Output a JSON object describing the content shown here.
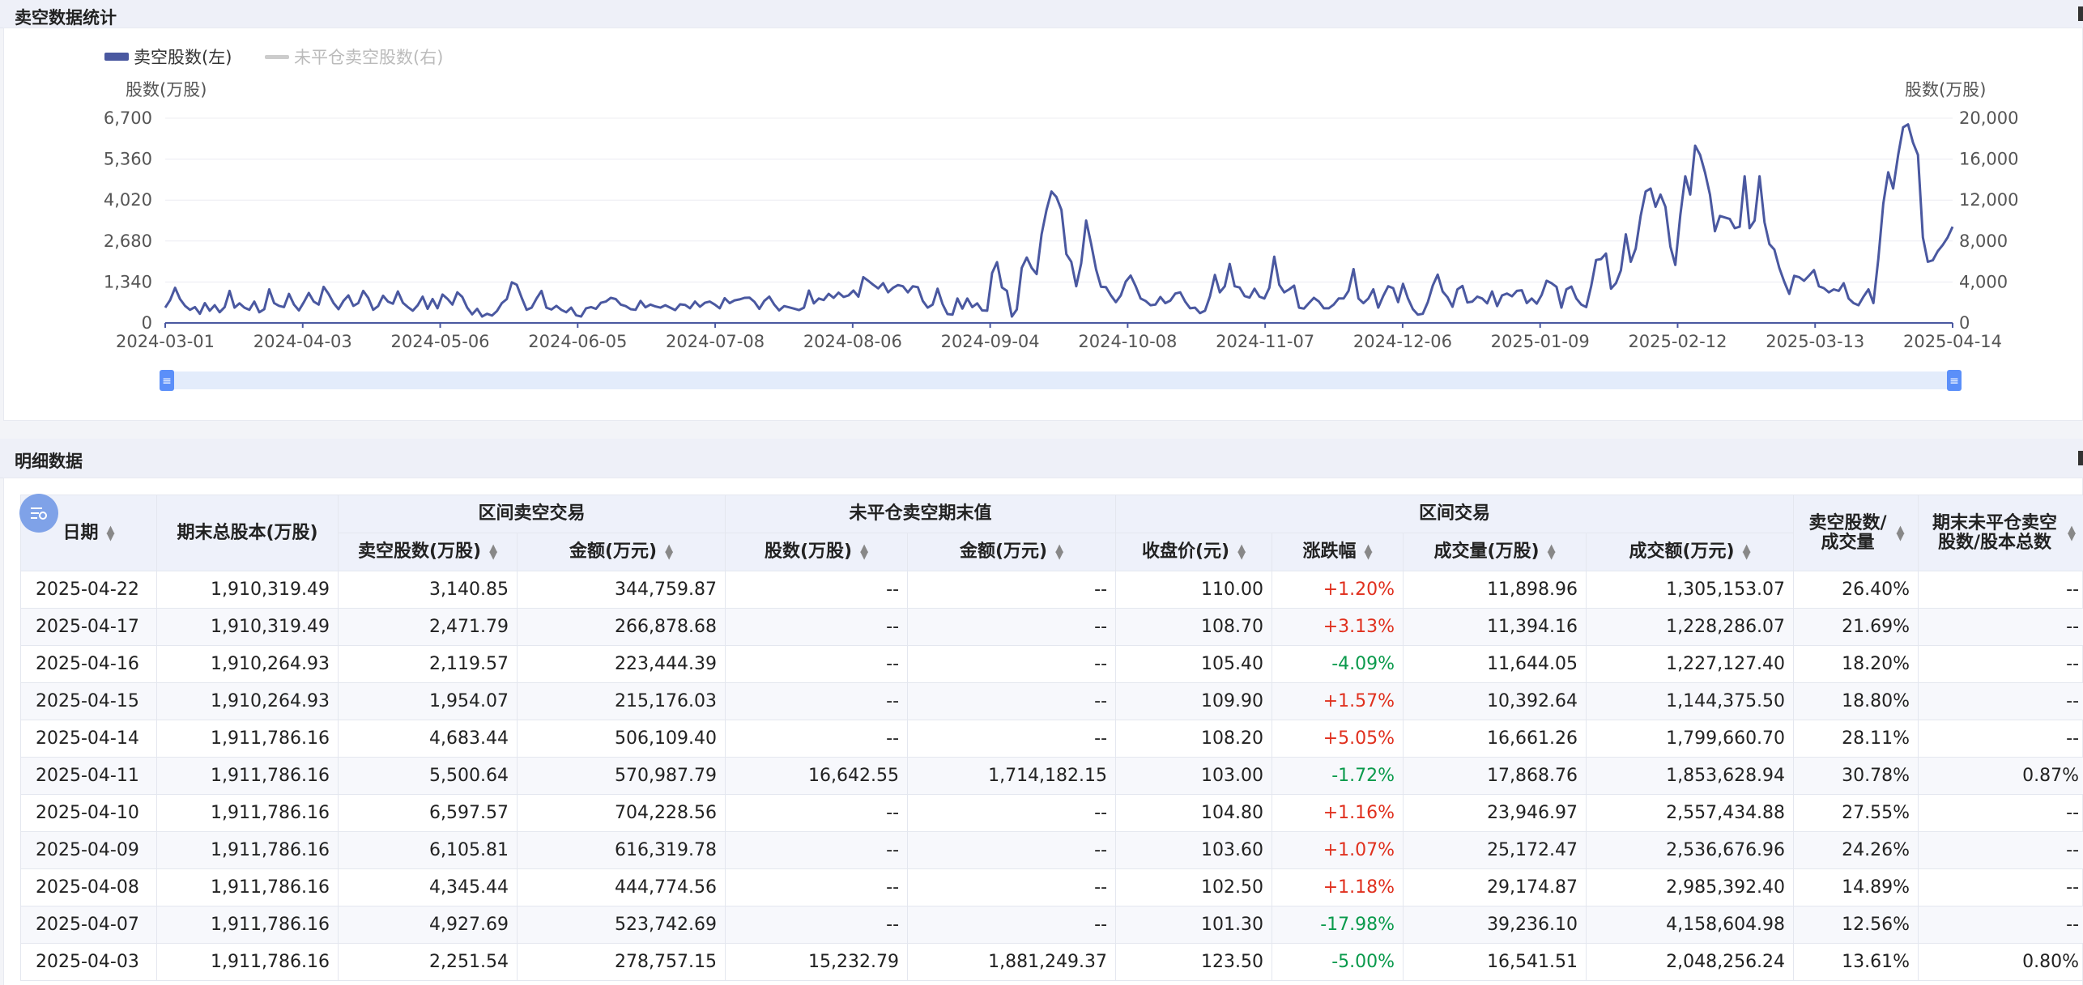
{
  "sections": {
    "chart_title": "卖空数据统计",
    "table_title": "明细数据"
  },
  "legend": {
    "series1": "卖空股数(左)",
    "series2": "未平仓卖空股数(右)"
  },
  "colors": {
    "series1": "#4a58a0",
    "series2_legend": "#cccccc",
    "accent": "#5b8ff9",
    "up": "#e0301e",
    "down": "#0a9a4c"
  },
  "icons": {
    "filter_badge": "table-filter-icon"
  },
  "chart_data": {
    "type": "line",
    "ylabel_left": "股数(万股)",
    "ylabel_right": "股数(万股)",
    "left_ticks": [
      "6,700",
      "5,360",
      "4,020",
      "2,680",
      "1,340",
      "0"
    ],
    "right_ticks": [
      "20,000",
      "16,000",
      "12,000",
      "8,000",
      "4,000",
      "0"
    ],
    "x_ticks": [
      "2024-03-01",
      "2024-04-03",
      "2024-05-06",
      "2024-06-05",
      "2024-07-08",
      "2024-08-06",
      "2024-09-04",
      "2024-10-08",
      "2024-11-07",
      "2024-12-06",
      "2025-01-09",
      "2025-02-12",
      "2025-03-13",
      "2025-04-14"
    ],
    "ylim_left": [
      0,
      6700
    ],
    "ylim_right": [
      0,
      20000
    ],
    "grid": true,
    "series": [
      {
        "name": "卖空股数(左)",
        "values": [
          500,
          750,
          1150,
          780,
          560,
          430,
          520,
          300,
          650,
          400,
          580,
          350,
          520,
          1050,
          500,
          640,
          500,
          430,
          700,
          350,
          450,
          1100,
          650,
          560,
          520,
          950,
          600,
          410,
          680,
          980,
          700,
          600,
          1180,
          950,
          650,
          450,
          720,
          900,
          560,
          650,
          1050,
          820,
          430,
          550,
          890,
          700,
          630,
          1030,
          660,
          520,
          400,
          580,
          860,
          460,
          780,
          480,
          930,
          790,
          600,
          1000,
          850,
          500,
          280,
          460,
          210,
          300,
          240,
          390,
          650,
          780,
          1330,
          1250,
          820,
          430,
          500,
          800,
          1050,
          500,
          440,
          560,
          430,
          350,
          500,
          250,
          210,
          480,
          520,
          460,
          660,
          700,
          820,
          780,
          600,
          550,
          450,
          430,
          720,
          510,
          600,
          540,
          500,
          580,
          500,
          420,
          610,
          590,
          480,
          700,
          530,
          660,
          700,
          600,
          480,
          810,
          650,
          740,
          770,
          820,
          830,
          690,
          460,
          720,
          860,
          600,
          410,
          550,
          510,
          470,
          420,
          500,
          1060,
          640,
          800,
          750,
          950,
          820,
          990,
          850,
          900,
          1060,
          860,
          1500,
          1380,
          1250,
          1130,
          1300,
          1000,
          1150,
          1240,
          1200,
          1000,
          1200,
          1170,
          720,
          500,
          600,
          1120,
          620,
          290,
          270,
          800,
          470,
          800,
          520,
          640,
          410,
          400,
          1630,
          1990,
          1160,
          1050,
          210,
          440,
          1800,
          2140,
          1800,
          1600,
          2900,
          3700,
          4300,
          4120,
          3700,
          2250,
          2000,
          1200,
          1950,
          3350,
          2600,
          1750,
          1180,
          1170,
          900,
          680,
          900,
          1350,
          1550,
          1200,
          800,
          720,
          580,
          600,
          850,
          650,
          730,
          960,
          1000,
          700,
          480,
          500,
          320,
          400,
          870,
          1570,
          1000,
          1200,
          1930,
          1200,
          1160,
          880,
          830,
          1120,
          860,
          800,
          1150,
          2170,
          1250,
          1000,
          1100,
          1220,
          500,
          470,
          650,
          820,
          700,
          480,
          480,
          600,
          800,
          800,
          1050,
          1760,
          800,
          650,
          800,
          1100,
          500,
          880,
          1200,
          1140,
          680,
          1280,
          800,
          450,
          270,
          300,
          680,
          1220,
          1580,
          1030,
          840,
          530,
          1100,
          1210,
          670,
          700,
          860,
          800,
          640,
          1030,
          550,
          900,
          960,
          870,
          1050,
          1070,
          650,
          800,
          630,
          920,
          1380,
          1300,
          1180,
          500,
          1100,
          1190,
          800,
          600,
          520,
          1200,
          2060,
          2090,
          2270,
          1120,
          1300,
          1720,
          2900,
          2000,
          2430,
          3500,
          4300,
          4400,
          3800,
          4200,
          3800,
          2500,
          1900,
          3530,
          4800,
          4200,
          5800,
          5500,
          4920,
          4200,
          3000,
          3500,
          3450,
          3400,
          3100,
          3150,
          4800,
          3100,
          3350,
          4800,
          3300,
          2580,
          2400,
          1800,
          1350,
          950,
          1540,
          1500,
          1380,
          1550,
          1730,
          1200,
          1140,
          1000,
          1100,
          1050,
          1300,
          800,
          650,
          580,
          860,
          1100,
          650,
          2100,
          3900,
          4930,
          4400,
          5500,
          6400,
          6500,
          5900,
          5500,
          2800,
          2000,
          2050,
          2350,
          2550,
          2800,
          3150
        ]
      }
    ]
  },
  "slider": {
    "start_handle": "≡",
    "end_handle": "≡"
  },
  "table": {
    "group_headers": {
      "date": "日期",
      "total_capital": "期末总股本(万股)",
      "short_trade": "区间卖空交易",
      "open_short": "未平仓卖空期末值",
      "trading": "区间交易",
      "short_ratio": "卖空股数/成交量",
      "open_ratio": "期末未平仓卖空股数/股本总数"
    },
    "sub_headers": {
      "short_shares": "卖空股数(万股)",
      "short_amount": "金额(万元)",
      "open_shares": "股数(万股)",
      "open_amount": "金额(万元)",
      "close": "收盘价(元)",
      "change": "涨跌幅",
      "volume": "成交量(万股)",
      "turnover": "成交额(万元)"
    },
    "rows": [
      {
        "date": "2025-04-22",
        "total": "1,910,319.49",
        "short_shares": "3,140.85",
        "short_amount": "344,759.87",
        "open_shares": "--",
        "open_amount": "--",
        "close": "110.00",
        "change": "+1.20%",
        "dir": "up",
        "volume": "11,898.96",
        "turnover": "1,305,153.07",
        "ratio": "26.40%",
        "open_ratio": "--"
      },
      {
        "date": "2025-04-17",
        "total": "1,910,319.49",
        "short_shares": "2,471.79",
        "short_amount": "266,878.68",
        "open_shares": "--",
        "open_amount": "--",
        "close": "108.70",
        "change": "+3.13%",
        "dir": "up",
        "volume": "11,394.16",
        "turnover": "1,228,286.07",
        "ratio": "21.69%",
        "open_ratio": "--"
      },
      {
        "date": "2025-04-16",
        "total": "1,910,264.93",
        "short_shares": "2,119.57",
        "short_amount": "223,444.39",
        "open_shares": "--",
        "open_amount": "--",
        "close": "105.40",
        "change": "-4.09%",
        "dir": "down",
        "volume": "11,644.05",
        "turnover": "1,227,127.40",
        "ratio": "18.20%",
        "open_ratio": "--"
      },
      {
        "date": "2025-04-15",
        "total": "1,910,264.93",
        "short_shares": "1,954.07",
        "short_amount": "215,176.03",
        "open_shares": "--",
        "open_amount": "--",
        "close": "109.90",
        "change": "+1.57%",
        "dir": "up",
        "volume": "10,392.64",
        "turnover": "1,144,375.50",
        "ratio": "18.80%",
        "open_ratio": "--"
      },
      {
        "date": "2025-04-14",
        "total": "1,911,786.16",
        "short_shares": "4,683.44",
        "short_amount": "506,109.40",
        "open_shares": "--",
        "open_amount": "--",
        "close": "108.20",
        "change": "+5.05%",
        "dir": "up",
        "volume": "16,661.26",
        "turnover": "1,799,660.70",
        "ratio": "28.11%",
        "open_ratio": "--"
      },
      {
        "date": "2025-04-11",
        "total": "1,911,786.16",
        "short_shares": "5,500.64",
        "short_amount": "570,987.79",
        "open_shares": "16,642.55",
        "open_amount": "1,714,182.15",
        "close": "103.00",
        "change": "-1.72%",
        "dir": "down",
        "volume": "17,868.76",
        "turnover": "1,853,628.94",
        "ratio": "30.78%",
        "open_ratio": "0.87%"
      },
      {
        "date": "2025-04-10",
        "total": "1,911,786.16",
        "short_shares": "6,597.57",
        "short_amount": "704,228.56",
        "open_shares": "--",
        "open_amount": "--",
        "close": "104.80",
        "change": "+1.16%",
        "dir": "up",
        "volume": "23,946.97",
        "turnover": "2,557,434.88",
        "ratio": "27.55%",
        "open_ratio": "--"
      },
      {
        "date": "2025-04-09",
        "total": "1,911,786.16",
        "short_shares": "6,105.81",
        "short_amount": "616,319.78",
        "open_shares": "--",
        "open_amount": "--",
        "close": "103.60",
        "change": "+1.07%",
        "dir": "up",
        "volume": "25,172.47",
        "turnover": "2,536,676.96",
        "ratio": "24.26%",
        "open_ratio": "--"
      },
      {
        "date": "2025-04-08",
        "total": "1,911,786.16",
        "short_shares": "4,345.44",
        "short_amount": "444,774.56",
        "open_shares": "--",
        "open_amount": "--",
        "close": "102.50",
        "change": "+1.18%",
        "dir": "up",
        "volume": "29,174.87",
        "turnover": "2,985,392.40",
        "ratio": "14.89%",
        "open_ratio": "--"
      },
      {
        "date": "2025-04-07",
        "total": "1,911,786.16",
        "short_shares": "4,927.69",
        "short_amount": "523,742.69",
        "open_shares": "--",
        "open_amount": "--",
        "close": "101.30",
        "change": "-17.98%",
        "dir": "down",
        "volume": "39,236.10",
        "turnover": "4,158,604.98",
        "ratio": "12.56%",
        "open_ratio": "--"
      },
      {
        "date": "2025-04-03",
        "total": "1,911,786.16",
        "short_shares": "2,251.54",
        "short_amount": "278,757.15",
        "open_shares": "15,232.79",
        "open_amount": "1,881,249.37",
        "close": "123.50",
        "change": "-5.00%",
        "dir": "down",
        "volume": "16,541.51",
        "turnover": "2,048,256.24",
        "ratio": "13.61%",
        "open_ratio": "0.80%"
      }
    ]
  }
}
